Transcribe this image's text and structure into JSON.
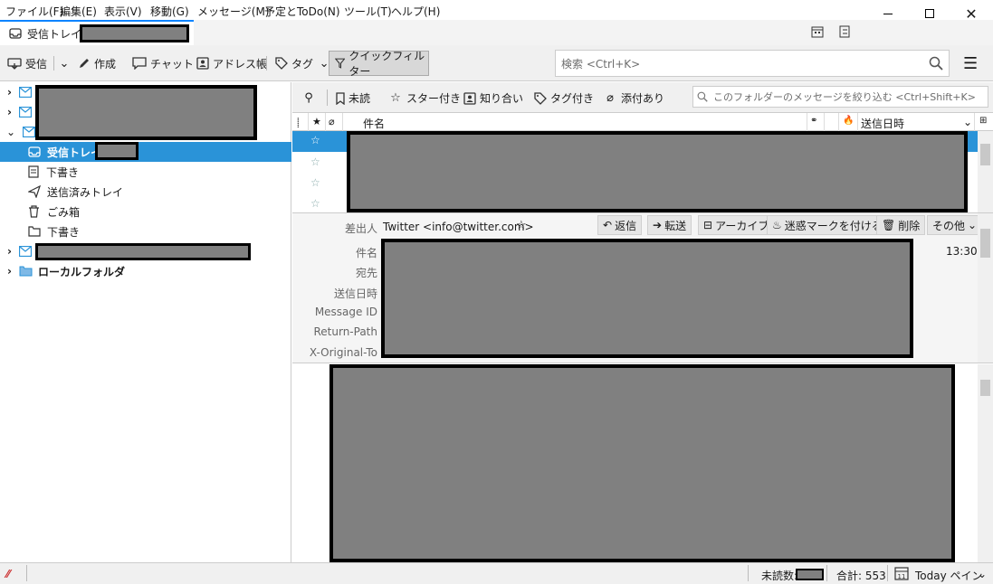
{
  "menu": [
    "ファイル(F)",
    "編集(E)",
    "表示(V)",
    "移動(G)",
    "メッセージ(M)",
    "予定とToDo(N)",
    "ツール(T)",
    "ヘルプ(H)"
  ],
  "tab": {
    "title": "受信トレイ -"
  },
  "toolbar": {
    "get_mail": "受信",
    "write": "作成",
    "chat": "チャット",
    "address_book": "アドレス帳",
    "tag": "タグ",
    "quick_filter": "クイックフィルター",
    "search_placeholder": "検索 <Ctrl+K>"
  },
  "folders": {
    "inbox": "受信トレイ",
    "drafts": "下書き",
    "sent": "送信済みトレイ",
    "trash": "ごみ箱",
    "drafts2": "下書き",
    "local": "ローカルフォルダ"
  },
  "quickfilter": {
    "unread": "未読",
    "starred": "スター付き",
    "contact": "知り合い",
    "tagged": "タグ付き",
    "attachment": "添付あり",
    "filter_placeholder": "このフォルダーのメッセージを絞り込む <Ctrl+Shift+K>"
  },
  "columns": {
    "subject": "件名",
    "date": "送信日時"
  },
  "header": {
    "from_label": "差出人",
    "from_value": "Twitter <info@twitter.com>",
    "subject_label": "件名",
    "to_label": "宛先",
    "date_label": "送信日時",
    "msgid_label": "Message ID",
    "returnpath_label": "Return-Path",
    "origto_label": "X-Original-To",
    "time": "13:30",
    "reply": "返信",
    "forward": "転送",
    "archive": "アーカイブ",
    "junk": "迷惑マークを付ける",
    "delete": "削除",
    "other": "その他"
  },
  "status": {
    "unread_label": "未読数:",
    "total": "合計: 553",
    "today_pane": "Today ペイン"
  },
  "colors": {
    "accent": "#2a93d8",
    "redact": "#808080"
  }
}
